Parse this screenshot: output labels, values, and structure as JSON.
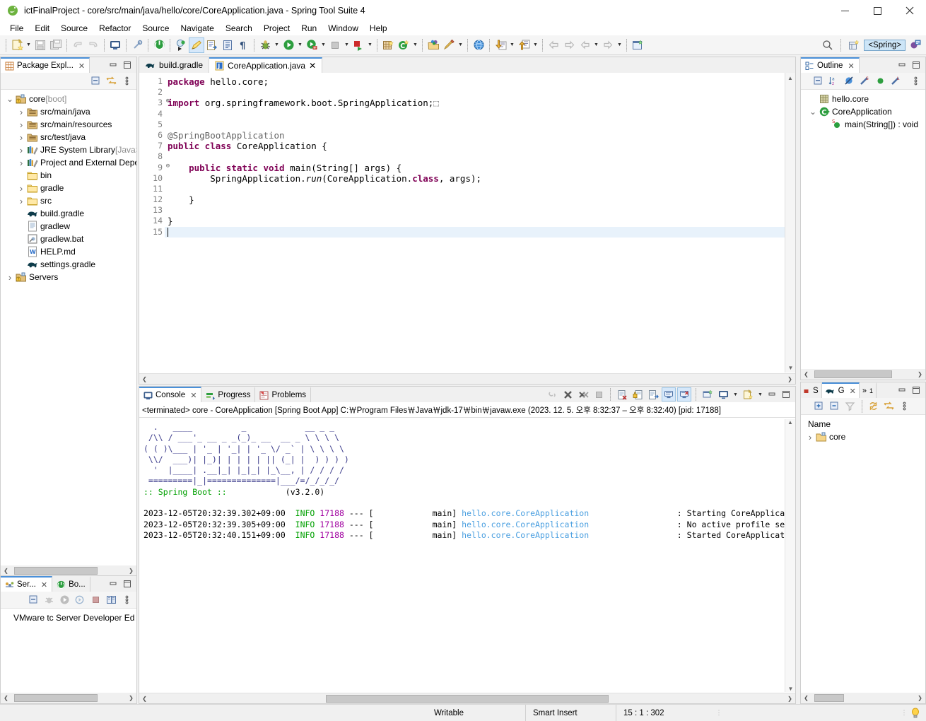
{
  "window": {
    "title": "ictFinalProject - core/src/main/java/hello/core/CoreApplication.java - Spring Tool Suite 4",
    "minimize": "—",
    "maximize": "☐",
    "close": "✕"
  },
  "menu": {
    "items": [
      "File",
      "Edit",
      "Source",
      "Refactor",
      "Source",
      "Navigate",
      "Search",
      "Project",
      "Run",
      "Window",
      "Help"
    ]
  },
  "toolbar": {
    "spring_perspective_label": "<Spring>",
    "icons": [
      "new-wizard-icon",
      "new-dropdown-arrow",
      "save-icon",
      "save-all-icon",
      "undo-icon",
      "redo-icon",
      "open-console-icon",
      "link-icon",
      "boot-dashboard-icon",
      "spring-boot-restart-icon",
      "annotate-icon",
      "open-type-icon",
      "open-task-icon",
      "show-whitespace-icon",
      "debug-icon",
      "debug-dropdown-arrow",
      "run-icon",
      "run-dropdown-arrow",
      "run-coverage-icon",
      "coverage-dropdown-arrow",
      "terminate-icon",
      "terminate-dropdown-arrow",
      "stop-relaunch-icon",
      "relaunch-dropdown-arrow",
      "new-package-icon",
      "new-class-icon",
      "new-class-dropdown-arrow",
      "open-resource-icon",
      "search-icon-toolbar",
      "search-dropdown-arrow",
      "web-browser-icon",
      "import-icon",
      "import-dropdown-arrow",
      "export-icon",
      "export-dropdown-arrow",
      "back-icon",
      "forward-star-icon",
      "prev-annotation-icon",
      "prev-dropdown-arrow",
      "next-annotation-icon",
      "next-dropdown-arrow",
      "new-editor-icon",
      "quick-access-search-icon",
      "open-perspective-icon",
      "spring-perspective-icon"
    ]
  },
  "package_explorer": {
    "tab_label": "Package Expl...",
    "close_glyph": "✕",
    "toolbar_icons": [
      "collapse-all-icon",
      "link-with-editor-icon",
      "view-menu-icon"
    ],
    "tree": [
      {
        "indent": 0,
        "arrow": "v",
        "icon": "project-icon",
        "label": "core",
        "suffix": " [boot]"
      },
      {
        "indent": 1,
        "arrow": ">",
        "icon": "source-folder-icon",
        "label": "src/main/java",
        "suffix": ""
      },
      {
        "indent": 1,
        "arrow": ">",
        "icon": "source-folder-icon",
        "label": "src/main/resources",
        "suffix": ""
      },
      {
        "indent": 1,
        "arrow": ">",
        "icon": "source-folder-icon",
        "label": "src/test/java",
        "suffix": ""
      },
      {
        "indent": 1,
        "arrow": ">",
        "icon": "library-icon",
        "label": "JRE System Library",
        "suffix": " [JavaS"
      },
      {
        "indent": 1,
        "arrow": ">",
        "icon": "library-icon",
        "label": "Project and External Depé",
        "suffix": ""
      },
      {
        "indent": 1,
        "arrow": "",
        "icon": "folder-icon",
        "label": "bin",
        "suffix": ""
      },
      {
        "indent": 1,
        "arrow": ">",
        "icon": "folder-icon",
        "label": "gradle",
        "suffix": ""
      },
      {
        "indent": 1,
        "arrow": ">",
        "icon": "folder-icon",
        "label": "src",
        "suffix": ""
      },
      {
        "indent": 1,
        "arrow": "",
        "icon": "gradle-file-icon",
        "label": "build.gradle",
        "suffix": ""
      },
      {
        "indent": 1,
        "arrow": "",
        "icon": "text-file-icon",
        "label": "gradlew",
        "suffix": ""
      },
      {
        "indent": 1,
        "arrow": "",
        "icon": "bat-file-icon",
        "label": "gradlew.bat",
        "suffix": ""
      },
      {
        "indent": 1,
        "arrow": "",
        "icon": "markdown-file-icon",
        "label": "HELP.md",
        "suffix": ""
      },
      {
        "indent": 1,
        "arrow": "",
        "icon": "gradle-file-icon",
        "label": "settings.gradle",
        "suffix": ""
      },
      {
        "indent": 0,
        "arrow": ">",
        "icon": "servers-icon",
        "label": "Servers",
        "suffix": ""
      }
    ]
  },
  "servers_panel": {
    "tabs": [
      {
        "label": "Ser...",
        "icon": "servers-icon",
        "active": true,
        "close": "✕"
      },
      {
        "label": "Bo...",
        "icon": "boot-dashboard-icon",
        "active": false,
        "close": ""
      }
    ],
    "toolbar_icons": [
      "collapse-all-icon",
      "debug-server-icon",
      "start-server-icon",
      "profile-server-icon",
      "stop-server-icon",
      "publish-icon",
      "view-menu-icon"
    ],
    "entries": [
      "VMware tc Server Developer Ed"
    ]
  },
  "editor": {
    "tabs": [
      {
        "label": "build.gradle",
        "icon": "gradle-file-icon",
        "active": false,
        "close": ""
      },
      {
        "label": "CoreApplication.java",
        "icon": "java-file-icon",
        "active": true,
        "close": "✕"
      }
    ],
    "line_numbers": [
      "1",
      "2",
      "3",
      "4",
      "5",
      "6",
      "7",
      "8",
      "9",
      "10",
      "11",
      "12",
      "13",
      "14",
      "15"
    ],
    "folds": {
      "3": "⊕",
      "9": "⊖"
    },
    "current_line": 15,
    "lines": [
      {
        "n": 1,
        "segments": [
          {
            "t": "package ",
            "c": "kw"
          },
          {
            "t": "hello.core;",
            "c": ""
          }
        ]
      },
      {
        "n": 2,
        "segments": []
      },
      {
        "n": 3,
        "segments": [
          {
            "t": "import ",
            "c": "kw"
          },
          {
            "t": "org.springframework.boot.SpringApplication;",
            "c": ""
          },
          {
            "t": "⬚",
            "c": "ann"
          }
        ]
      },
      {
        "n": 4,
        "segments": []
      },
      {
        "n": 5,
        "segments": []
      },
      {
        "n": 6,
        "segments": [
          {
            "t": "@SpringBootApplication",
            "c": "ann"
          }
        ]
      },
      {
        "n": 7,
        "segments": [
          {
            "t": "public class ",
            "c": "kw"
          },
          {
            "t": "CoreApplication {",
            "c": ""
          }
        ]
      },
      {
        "n": 8,
        "segments": []
      },
      {
        "n": 9,
        "segments": [
          {
            "t": "    ",
            "c": ""
          },
          {
            "t": "public static void ",
            "c": "kw"
          },
          {
            "t": "main(String[] args) {",
            "c": ""
          }
        ]
      },
      {
        "n": 10,
        "segments": [
          {
            "t": "        SpringApplication.",
            "c": ""
          },
          {
            "t": "run",
            "c": "ital"
          },
          {
            "t": "(CoreApplication.",
            "c": ""
          },
          {
            "t": "class",
            "c": "kw"
          },
          {
            "t": ", args);",
            "c": ""
          }
        ]
      },
      {
        "n": 11,
        "segments": []
      },
      {
        "n": 12,
        "segments": [
          {
            "t": "    }",
            "c": ""
          }
        ]
      },
      {
        "n": 13,
        "segments": []
      },
      {
        "n": 14,
        "segments": [
          {
            "t": "}",
            "c": ""
          }
        ]
      },
      {
        "n": 15,
        "segments": []
      }
    ]
  },
  "outline": {
    "tab_label": "Outline",
    "close_glyph": "✕",
    "toolbar_icons": [
      "collapse-all-icon",
      "sort-alpha-icon",
      "hide-fields-icon",
      "hide-static-icon",
      "hide-nonpublic-icon",
      "hide-local-types-icon",
      "view-menu-icon"
    ],
    "tree": [
      {
        "indent": 0,
        "arrow": "",
        "icon": "package-icon",
        "label": "hello.core"
      },
      {
        "indent": 0,
        "arrow": "v",
        "icon": "class-icon",
        "label": "CoreApplication"
      },
      {
        "indent": 1,
        "arrow": "",
        "icon": "method-public-static-icon",
        "label": "main(String[]) : void"
      }
    ]
  },
  "console": {
    "tabs": [
      {
        "label": "Console",
        "icon": "console-icon",
        "active": true,
        "close": "✕"
      },
      {
        "label": "Progress",
        "icon": "progress-icon",
        "active": false,
        "close": ""
      },
      {
        "label": "Problems",
        "icon": "problems-icon",
        "active": false,
        "close": ""
      }
    ],
    "toolbar_icons": [
      "terminate-all-icon",
      "remove-launch-icon",
      "remove-all-terminated-icon",
      "stop-icon",
      "clear-console-icon",
      "lock-scroll-icon",
      "show-on-output-icon",
      "pin-console-icon",
      "display-selected-console-icon",
      "open-console-icon",
      "new-console-view-icon",
      "new-console-dropdown-arrow",
      "open-console-dropdown-icon",
      "open-console-dropdown-arrow"
    ],
    "launch_header": "<terminated> core - CoreApplication [Spring Boot App] C:￦Program Files￦Java￦jdk-17￦bin￦javaw.exe  (2023. 12. 5. 오후 8:32:37 – 오후 8:32:40) [pid: 17188]",
    "banner": [
      "  .   ____          _            __ _ _",
      " /\\\\ / ___'_ __ _ _(_)_ __  __ _ \\ \\ \\ \\",
      "( ( )\\___ | '_ | '_| | '_ \\/ _` | \\ \\ \\ \\",
      " \\\\/  ___)| |_)| | | | | || (_| |  ) ) ) )",
      "  '  |____| .__|_| |_|_| |_\\__, | / / / /",
      " =========|_|==============|___/=/_/_/_/"
    ],
    "banner_line": ":: Spring Boot ::",
    "banner_version": "(v3.2.0)",
    "log_lines": [
      {
        "ts": "2023-12-05T20:32:39.302+09:00",
        "level": "INFO",
        "pid": "17188",
        "dash": "--- [",
        "thread": "main]",
        "logger": "hello.core.CoreApplication",
        "sep": ":",
        "msg": "Starting CoreApplicatio"
      },
      {
        "ts": "2023-12-05T20:32:39.305+09:00",
        "level": "INFO",
        "pid": "17188",
        "dash": "--- [",
        "thread": "main]",
        "logger": "hello.core.CoreApplication",
        "sep": ":",
        "msg": "No active profile set, "
      },
      {
        "ts": "2023-12-05T20:32:40.151+09:00",
        "level": "INFO",
        "pid": "17188",
        "dash": "--- [",
        "thread": "main]",
        "logger": "hello.core.CoreApplication",
        "sep": ":",
        "msg": "Started CoreApplication"
      }
    ]
  },
  "explorer_panel": {
    "tabs": [
      {
        "label": "S",
        "icon": "stop-square-icon",
        "active": false,
        "close": ""
      },
      {
        "label": "G",
        "icon": "gradle-elephant-icon",
        "active": true,
        "close": "✕"
      },
      {
        "label": "»",
        "icon": "more-tabs-icon",
        "active": false,
        "badge": "1",
        "close": ""
      }
    ],
    "toolbar_icons": [
      "expand-all-icon",
      "collapse-all-icon",
      "filter-icon",
      "refresh-icon",
      "link-with-editor-icon",
      "view-menu-icon"
    ],
    "column_header": "Name",
    "rows": [
      {
        "arrow": ">",
        "icon": "project-folder-icon",
        "label": "core"
      }
    ]
  },
  "statusbar": {
    "writable": "Writable",
    "insert_mode": "Smart Insert",
    "position": "15 : 1 : 302",
    "tip_icon": "lightbulb-icon"
  },
  "colors": {
    "accent": "#4a90d9",
    "selected_tab_bg": "#ffffff",
    "panel_bg": "#f0f0f0",
    "keyword": "#7f0055",
    "annotation": "#646464",
    "log_info": "#00a000",
    "log_pid": "#a000a0",
    "log_logger": "#4a9fe0",
    "current_line": "#e8f2fb"
  }
}
